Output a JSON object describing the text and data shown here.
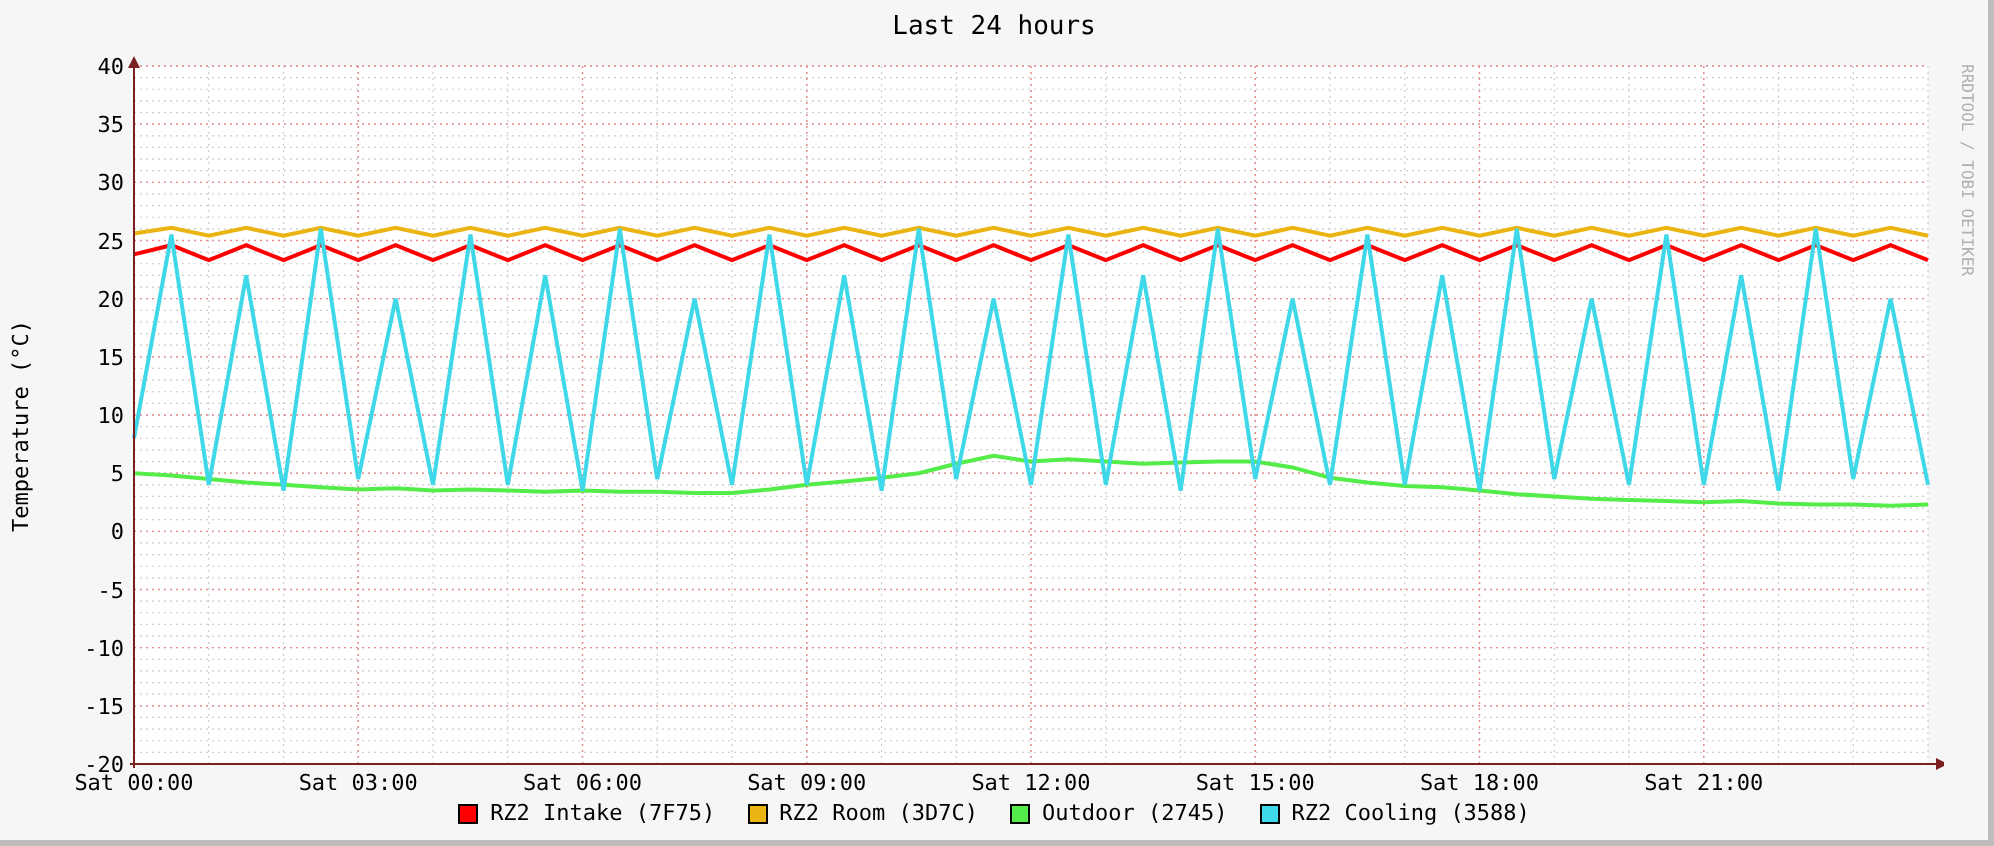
{
  "graph": {
    "credit": "RRDTOOL / TOBI OETIKER",
    "chart_data": {
      "type": "line",
      "grid": true,
      "title": "Last 24 hours",
      "ylabel": "Temperature (°C)",
      "ylim": [
        -20,
        40
      ],
      "categories": [
        "Sat 00:00",
        null,
        null,
        null,
        null,
        null,
        "Sat 03:00",
        null,
        null,
        null,
        null,
        null,
        "Sat 06:00",
        null,
        null,
        null,
        null,
        null,
        "Sat 09:00",
        null,
        null,
        null,
        null,
        null,
        "Sat 12:00",
        null,
        null,
        null,
        null,
        null,
        "Sat 15:00",
        null,
        null,
        null,
        null,
        null,
        "Sat 18:00",
        null,
        null,
        null,
        null,
        null,
        "Sat 21:00",
        null,
        null,
        null,
        null,
        null,
        null
      ],
      "yticks": [
        -20,
        -15,
        -10,
        -5,
        0,
        5,
        10,
        15,
        20,
        25,
        30,
        35,
        40
      ],
      "series": [
        {
          "name": "RZ2 Intake (7F75)",
          "color": "#ff0000",
          "values": [
            23.8,
            24.6,
            23.3,
            24.6,
            23.3,
            24.6,
            23.3,
            24.6,
            23.3,
            24.6,
            23.3,
            24.6,
            23.3,
            24.6,
            23.3,
            24.6,
            23.3,
            24.6,
            23.3,
            24.6,
            23.3,
            24.6,
            23.3,
            24.6,
            23.3,
            24.6,
            23.3,
            24.6,
            23.3,
            24.6,
            23.3,
            24.6,
            23.3,
            24.6,
            23.3,
            24.6,
            23.3,
            24.6,
            23.3,
            24.6,
            23.3,
            24.6,
            23.3,
            24.6,
            23.3,
            24.6,
            23.3,
            24.6,
            23.3
          ]
        },
        {
          "name": "RZ2 Room (3D7C)",
          "color": "#eab412",
          "values": [
            25.6,
            26.1,
            25.4,
            26.1,
            25.4,
            26.1,
            25.4,
            26.1,
            25.4,
            26.1,
            25.4,
            26.1,
            25.4,
            26.1,
            25.4,
            26.1,
            25.4,
            26.1,
            25.4,
            26.1,
            25.4,
            26.1,
            25.4,
            26.1,
            25.4,
            26.1,
            25.4,
            26.1,
            25.4,
            26.1,
            25.4,
            26.1,
            25.4,
            26.1,
            25.4,
            26.1,
            25.4,
            26.1,
            25.4,
            26.1,
            25.4,
            26.1,
            25.4,
            26.1,
            25.4,
            26.1,
            25.4,
            26.1,
            25.4
          ]
        },
        {
          "name": "Outdoor (2745)",
          "color": "#54ec48",
          "values": [
            5.0,
            4.8,
            4.5,
            4.2,
            4.0,
            3.8,
            3.6,
            3.7,
            3.5,
            3.6,
            3.5,
            3.4,
            3.5,
            3.4,
            3.4,
            3.3,
            3.3,
            3.6,
            4.0,
            4.3,
            4.6,
            5.0,
            5.8,
            6.5,
            6.0,
            6.2,
            6.0,
            5.8,
            5.9,
            6.0,
            6.0,
            5.5,
            4.6,
            4.2,
            3.9,
            3.8,
            3.5,
            3.2,
            3.0,
            2.8,
            2.7,
            2.6,
            2.5,
            2.6,
            2.4,
            2.3,
            2.3,
            2.2,
            2.3
          ]
        },
        {
          "name": "RZ2 Cooling (3588)",
          "color": "#3ed8e8",
          "values": [
            8,
            25.5,
            4,
            22,
            3.5,
            26,
            4.5,
            20,
            4,
            25.5,
            4,
            22,
            3.5,
            26,
            4.5,
            20,
            4,
            25.5,
            4,
            22,
            3.5,
            26,
            4.5,
            20,
            4,
            25.5,
            4,
            22,
            3.5,
            26,
            4.5,
            20,
            4,
            25.5,
            4,
            22,
            3.5,
            26,
            4.5,
            20,
            4,
            25.5,
            4,
            22,
            3.5,
            26,
            4.5,
            20,
            4
          ]
        }
      ]
    }
  }
}
